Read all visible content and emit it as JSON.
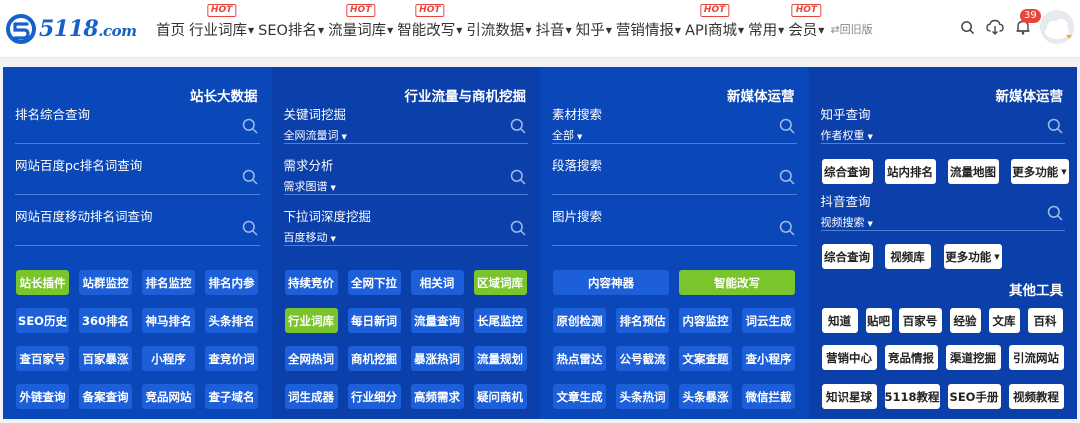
{
  "header": {
    "logo": {
      "text": "5118",
      "suffix": ".com"
    },
    "nav": [
      {
        "label": "首页",
        "caret": false,
        "hot": false
      },
      {
        "label": "行业词库",
        "caret": true,
        "hot": true
      },
      {
        "label": "SEO排名",
        "caret": true,
        "hot": false
      },
      {
        "label": "流量词库",
        "caret": true,
        "hot": true
      },
      {
        "label": "智能改写",
        "caret": true,
        "hot": true
      },
      {
        "label": "引流数据",
        "caret": true,
        "hot": false
      },
      {
        "label": "抖音",
        "caret": true,
        "hot": false
      },
      {
        "label": "知乎",
        "caret": true,
        "hot": false
      },
      {
        "label": "营销情报",
        "caret": true,
        "hot": false
      },
      {
        "label": "API商城",
        "caret": true,
        "hot": true
      },
      {
        "label": "常用",
        "caret": true,
        "hot": false
      },
      {
        "label": "会员",
        "caret": true,
        "hot": true
      }
    ],
    "hot_label": "HOT",
    "caret_glyph": "▼",
    "back_old": "⇄回旧版",
    "message_count": "39",
    "icons": [
      "search-icon",
      "cloud-download-icon",
      "bell-icon"
    ]
  },
  "columns": [
    {
      "title": "站长大数据",
      "queries": [
        {
          "label": "排名综合查询",
          "select": ""
        },
        {
          "label": "网站百度pc排名词查询",
          "select": ""
        },
        {
          "label": "网站百度移动排名词查询",
          "select": ""
        }
      ],
      "buttons": [
        [
          {
            "label": "站长插件",
            "style": "green"
          },
          {
            "label": "站群监控",
            "style": "blue"
          },
          {
            "label": "排名监控",
            "style": "blue"
          },
          {
            "label": "排名内参",
            "style": "blue"
          }
        ],
        [
          {
            "label": "SEO历史",
            "style": "blue"
          },
          {
            "label": "360排名",
            "style": "blue"
          },
          {
            "label": "神马排名",
            "style": "blue"
          },
          {
            "label": "头条排名",
            "style": "blue"
          }
        ],
        [
          {
            "label": "查百家号",
            "style": "blue"
          },
          {
            "label": "百家暴涨",
            "style": "blue"
          },
          {
            "label": "小程序",
            "style": "blue"
          },
          {
            "label": "查竞价词",
            "style": "blue"
          }
        ],
        [
          {
            "label": "外链查询",
            "style": "blue"
          },
          {
            "label": "备案查询",
            "style": "blue"
          },
          {
            "label": "竞品网站",
            "style": "blue"
          },
          {
            "label": "查子域名",
            "style": "blue"
          }
        ]
      ]
    },
    {
      "title": "行业流量与商机挖掘",
      "queries": [
        {
          "label": "关键词挖掘",
          "select": "全网流量词"
        },
        {
          "label": "需求分析",
          "select": "需求图谱"
        },
        {
          "label": "下拉词深度挖掘",
          "select": "百度移动"
        }
      ],
      "buttons": [
        [
          {
            "label": "持续竞价",
            "style": "blue"
          },
          {
            "label": "全网下拉",
            "style": "blue"
          },
          {
            "label": "相关词",
            "style": "blue"
          },
          {
            "label": "区域词库",
            "style": "green"
          }
        ],
        [
          {
            "label": "行业词库",
            "style": "green"
          },
          {
            "label": "每日新词",
            "style": "blue"
          },
          {
            "label": "流量查询",
            "style": "blue"
          },
          {
            "label": "长尾监控",
            "style": "blue"
          }
        ],
        [
          {
            "label": "全网热词",
            "style": "blue"
          },
          {
            "label": "商机挖掘",
            "style": "blue"
          },
          {
            "label": "暴涨热词",
            "style": "blue"
          },
          {
            "label": "流量规划",
            "style": "blue"
          }
        ],
        [
          {
            "label": "词生成器",
            "style": "blue"
          },
          {
            "label": "行业细分",
            "style": "blue"
          },
          {
            "label": "高频需求",
            "style": "blue"
          },
          {
            "label": "疑问商机",
            "style": "blue"
          }
        ]
      ]
    },
    {
      "title": "新媒体运营",
      "queries": [
        {
          "label": "素材搜索",
          "select": "全部"
        },
        {
          "label": "段落搜索",
          "select": ""
        },
        {
          "label": "图片搜索",
          "select": ""
        }
      ],
      "wide_buttons": [
        {
          "label": "内容神器",
          "style": "blue"
        },
        {
          "label": "智能改写",
          "style": "green"
        }
      ],
      "buttons": [
        [
          {
            "label": "原创检测",
            "style": "blue"
          },
          {
            "label": "排名预估",
            "style": "blue"
          },
          {
            "label": "内容监控",
            "style": "blue"
          },
          {
            "label": "词云生成",
            "style": "blue"
          }
        ],
        [
          {
            "label": "热点雷达",
            "style": "blue"
          },
          {
            "label": "公号截流",
            "style": "blue"
          },
          {
            "label": "文案查题",
            "style": "blue"
          },
          {
            "label": "查小程序",
            "style": "blue"
          }
        ],
        [
          {
            "label": "文章生成",
            "style": "blue"
          },
          {
            "label": "头条热词",
            "style": "blue"
          },
          {
            "label": "头条暴涨",
            "style": "blue"
          },
          {
            "label": "微信拦截",
            "style": "blue"
          }
        ]
      ]
    },
    {
      "title": "新媒体运营",
      "zhihu": {
        "label": "知乎查询",
        "select": "作者权重"
      },
      "zhihu_buttons": [
        {
          "label": "综合查询"
        },
        {
          "label": "站内排名"
        },
        {
          "label": "流量地图"
        },
        {
          "label": "更多功能",
          "caret": true
        }
      ],
      "douyin": {
        "label": "抖音查询",
        "select": "视频搜索"
      },
      "douyin_buttons": [
        {
          "label": "综合查询"
        },
        {
          "label": "视频库"
        },
        {
          "label": "更多功能",
          "caret": true
        }
      ],
      "other_title": "其他工具",
      "other_rows": [
        [
          "知道",
          "贴吧",
          "百家号",
          "经验",
          "文库",
          "百科"
        ],
        [
          "营销中心",
          "竞品情报",
          "渠道挖掘",
          "引流网站"
        ],
        [
          "知识星球",
          "5118教程",
          "SEO手册",
          "视频教程"
        ]
      ]
    }
  ]
}
